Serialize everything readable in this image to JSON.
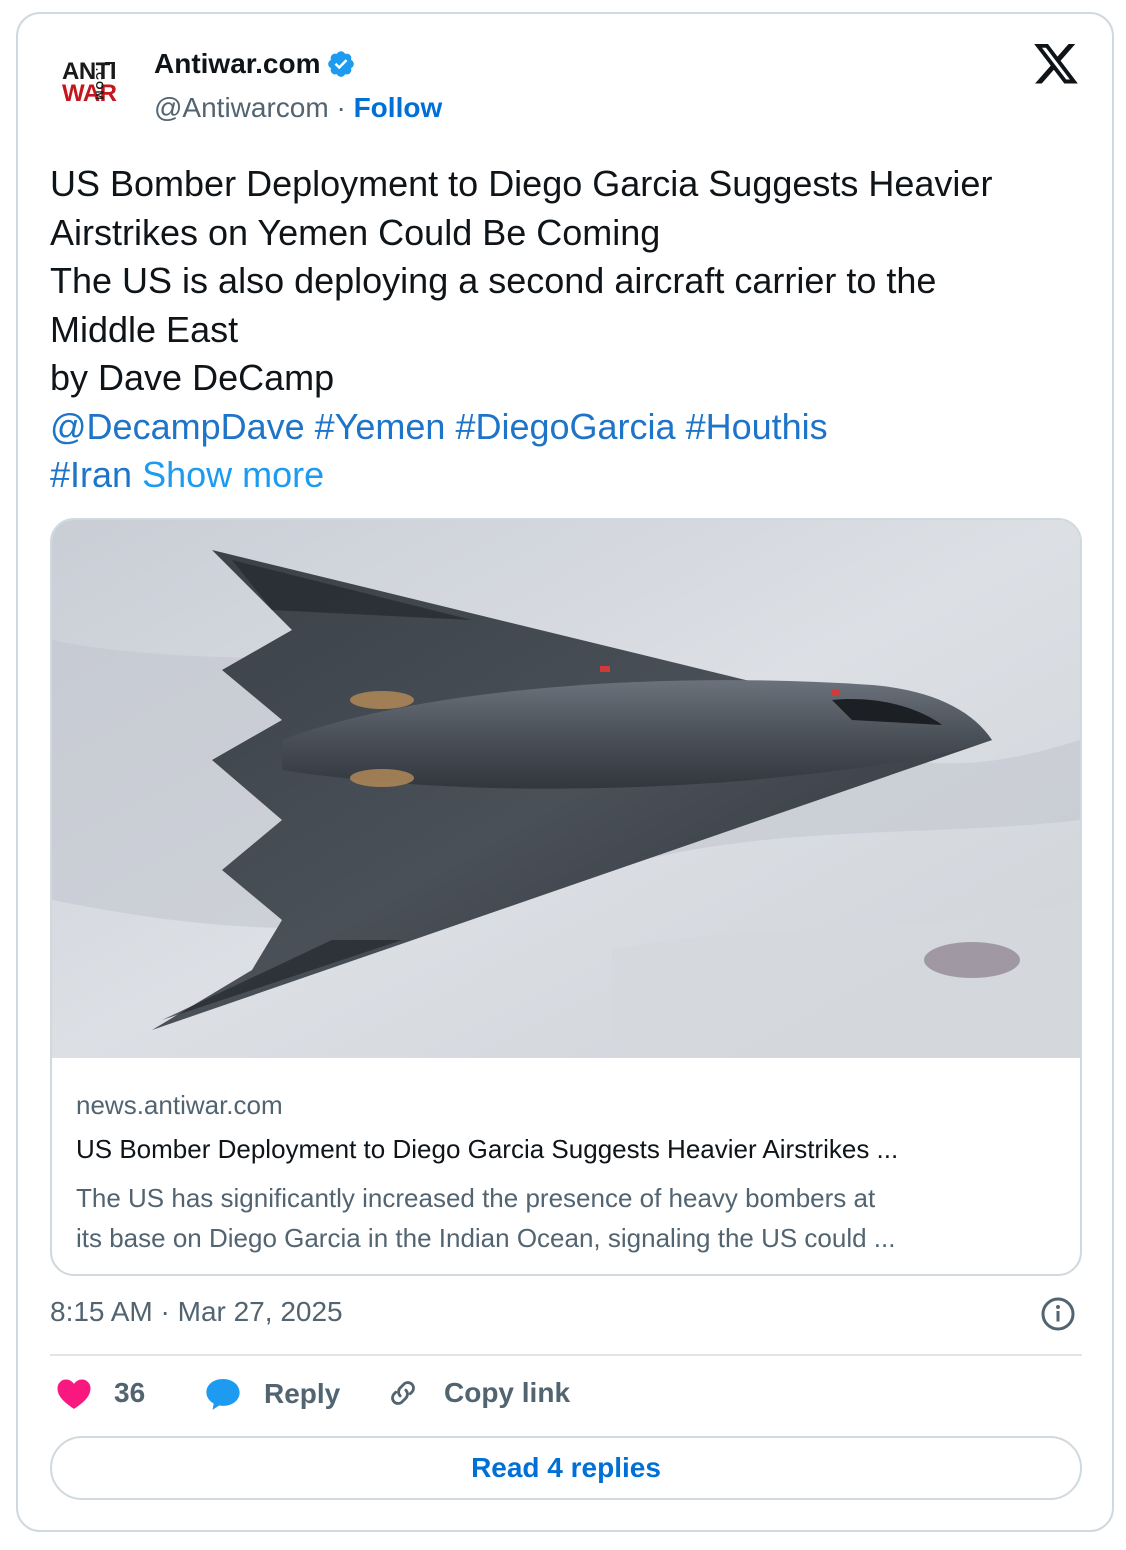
{
  "account": {
    "name": "Antiwar.com",
    "handle": "@Antiwarcom",
    "separator": "·",
    "follow_label": "Follow",
    "avatar_text_top": "ANTI",
    "avatar_text_bottom": "WAR",
    "avatar_text_side": ".COM",
    "verified_color": "#1d9bf0"
  },
  "tweet": {
    "lines": [
      "US Bomber Deployment to Diego Garcia Suggests Heavier",
      "Airstrikes on Yemen Could Be Coming",
      "The US is also deploying a second aircraft carrier to the",
      "Middle East",
      "by Dave DeCamp"
    ],
    "tags_line1": [
      "@DecampDave",
      "#Yemen",
      "#DiegoGarcia",
      "#Houthis"
    ],
    "tags_line2": [
      "#Iran"
    ],
    "show_more": "Show more"
  },
  "link_card": {
    "image_subject": "B-2 stealth bomber in flight over desert",
    "domain": "news.antiwar.com",
    "title": "US Bomber Deployment to Diego Garcia Suggests Heavier Airstrikes ...",
    "description_lines": [
      "The US has significantly increased the presence of heavy bombers at",
      "its base on Diego Garcia in the Indian Ocean, signaling the US could ..."
    ]
  },
  "timestamp": "8:15 AM · Mar 27, 2025",
  "actions": {
    "like_count": "36",
    "reply_label": "Reply",
    "copy_label": "Copy link"
  },
  "read_replies_label": "Read 4 replies",
  "colors": {
    "link": "#1d74c8",
    "like": "#f91880",
    "reply_icon": "#1d9bf0",
    "border": "#cfd9de"
  },
  "icons": [
    "x-logo-icon",
    "verified-badge-icon",
    "info-icon",
    "heart-icon",
    "reply-bubble-icon",
    "link-icon"
  ]
}
